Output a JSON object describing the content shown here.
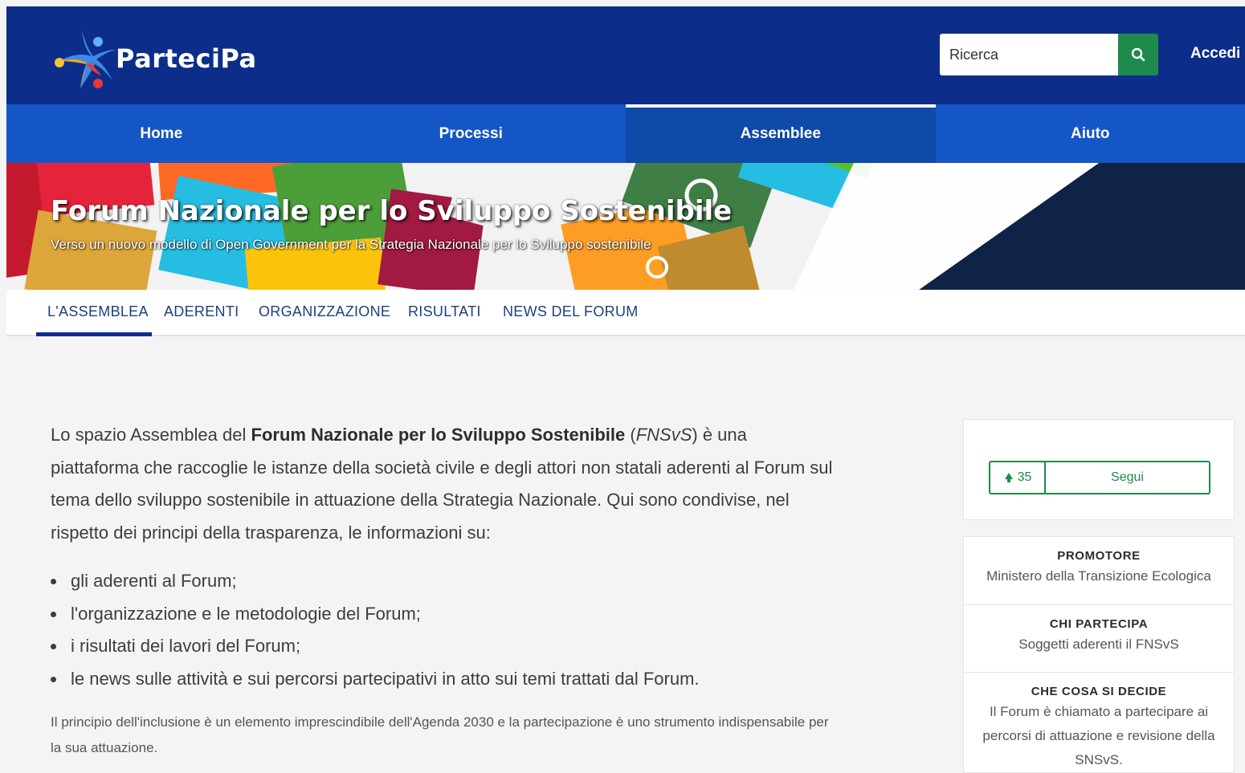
{
  "header": {
    "logo_text": "ParteciPa",
    "search_placeholder": "Ricerca",
    "login_label": "Accedi",
    "colors": {
      "header_bg": "#0c2e8a",
      "nav_bg": "#1556c6",
      "search_button": "#1e8a4c"
    }
  },
  "nav": {
    "items": [
      {
        "label": "Home",
        "active": false
      },
      {
        "label": "Processi",
        "active": false
      },
      {
        "label": "Assemblee",
        "active": true
      },
      {
        "label": "Aiuto",
        "active": false
      }
    ]
  },
  "hero": {
    "title": "Forum Nazionale per lo Sviluppo Sostenibile",
    "subtitle": "Verso un nuovo modello di Open Government per la Strategia Nazionale per lo Sviluppo sostenibile"
  },
  "subnav": {
    "tabs": [
      {
        "label": "L'ASSEMBLEA",
        "active": true
      },
      {
        "label": "ADERENTI",
        "active": false
      },
      {
        "label": "ORGANIZZAZIONE",
        "active": false
      },
      {
        "label": "RISULTATI",
        "active": false
      },
      {
        "label": "NEWS DEL FORUM",
        "active": false
      }
    ]
  },
  "main": {
    "intro_prefix": "Lo spazio Assemblea del ",
    "intro_bold": "Forum Nazionale per lo Sviluppo Sostenibile",
    "intro_open_paren": " (",
    "intro_italic": "FNSvS",
    "intro_suffix": ") è una piattaforma che raccoglie le istanze della società civile e degli attori non statali aderenti al Forum sul tema dello sviluppo sostenibile in attuazione della Strategia Nazionale. Qui sono condivise, nel rispetto dei principi della trasparenza, le informazioni su:",
    "bullets": [
      "gli aderenti al Forum;",
      "l'organizzazione e le metodologie del Forum;",
      "i risultati dei lavori del Forum;",
      "le news sulle attività e sui percorsi partecipativi in atto sui temi trattati dal Forum."
    ],
    "note": "Il principio dell'inclusione è un elemento imprescindibile dell'Agenda 2030 e la partecipazione è uno strumento indispensabile per la sua attuazione."
  },
  "sidebar": {
    "follow": {
      "count": "35",
      "label": "Segui",
      "icon": "followers-icon"
    },
    "sections": [
      {
        "heading": "PROMOTORE",
        "value": "Ministero della Transizione Ecologica"
      },
      {
        "heading": "CHI PARTECIPA",
        "value": "Soggetti aderenti il FNSvS"
      },
      {
        "heading": "CHE COSA SI DECIDE",
        "value": "Il Forum è chiamato a partecipare ai percorsi di attuazione e revisione della SNSvS."
      }
    ]
  }
}
